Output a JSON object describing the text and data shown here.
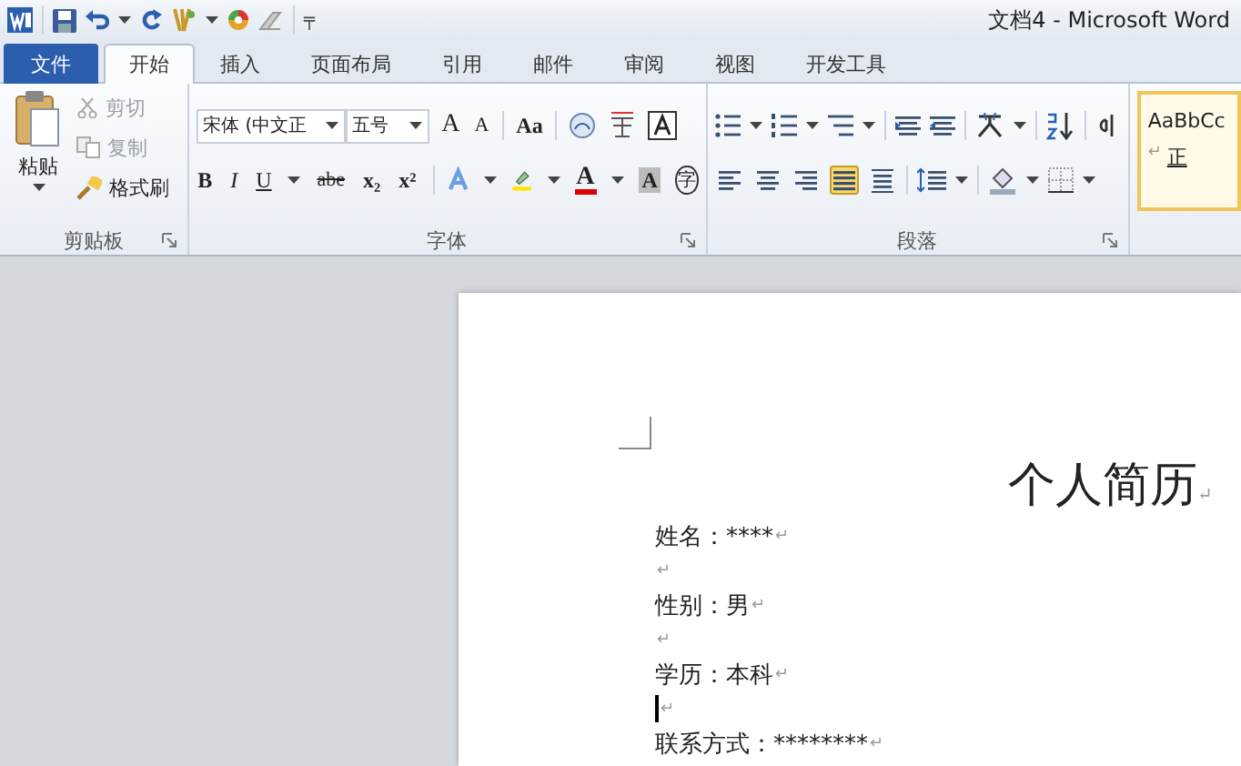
{
  "window": {
    "title": "文档4 - Microsoft Word"
  },
  "quick_access": {
    "more": "╤"
  },
  "tabs": [
    {
      "label": "文件",
      "kind": "file",
      "selected": false
    },
    {
      "label": "开始",
      "kind": "tab",
      "selected": true
    },
    {
      "label": "插入",
      "kind": "tab",
      "selected": false
    },
    {
      "label": "页面布局",
      "kind": "tab",
      "selected": false
    },
    {
      "label": "引用",
      "kind": "tab",
      "selected": false
    },
    {
      "label": "邮件",
      "kind": "tab",
      "selected": false
    },
    {
      "label": "审阅",
      "kind": "tab",
      "selected": false
    },
    {
      "label": "视图",
      "kind": "tab",
      "selected": false
    },
    {
      "label": "开发工具",
      "kind": "tab",
      "selected": false
    }
  ],
  "clipboard": {
    "label": "剪贴板",
    "paste": "粘贴",
    "items": [
      {
        "label": "剪切",
        "disabled": true
      },
      {
        "label": "复制",
        "disabled": true
      },
      {
        "label": "格式刷",
        "disabled": false
      }
    ]
  },
  "font": {
    "label": "字体",
    "font_name": "宋体 (中文正",
    "font_size": "五号",
    "grow": "A",
    "shrink": "A",
    "change_case": "Aa",
    "bold": "B",
    "italic": "I",
    "underline": "U",
    "strike": "abe",
    "subscript": "x₂",
    "superscript": "x²",
    "font_color": "A",
    "shading": "A",
    "enclose": "字"
  },
  "paragraph": {
    "label": "段落",
    "alignment": [
      {
        "selected": false
      },
      {
        "selected": false
      },
      {
        "selected": false
      },
      {
        "selected": true
      },
      {
        "selected": false
      }
    ]
  },
  "styles": {
    "sample": "AaBbCc",
    "name": "正",
    "mark": "↵"
  },
  "document": {
    "title": "个人简历",
    "title_mark": "↵",
    "lines": [
      {
        "kind": "text",
        "text": "姓名：****",
        "mark": "↵"
      },
      {
        "kind": "empty",
        "mark": "↵"
      },
      {
        "kind": "text",
        "text": "性别：男",
        "mark": "↵"
      },
      {
        "kind": "empty",
        "mark": "↵"
      },
      {
        "kind": "text",
        "text": "学历：本科",
        "mark": "↵"
      },
      {
        "kind": "cursor",
        "mark": "↵"
      },
      {
        "kind": "text",
        "text": "联系方式：********",
        "mark": "↵"
      }
    ]
  }
}
